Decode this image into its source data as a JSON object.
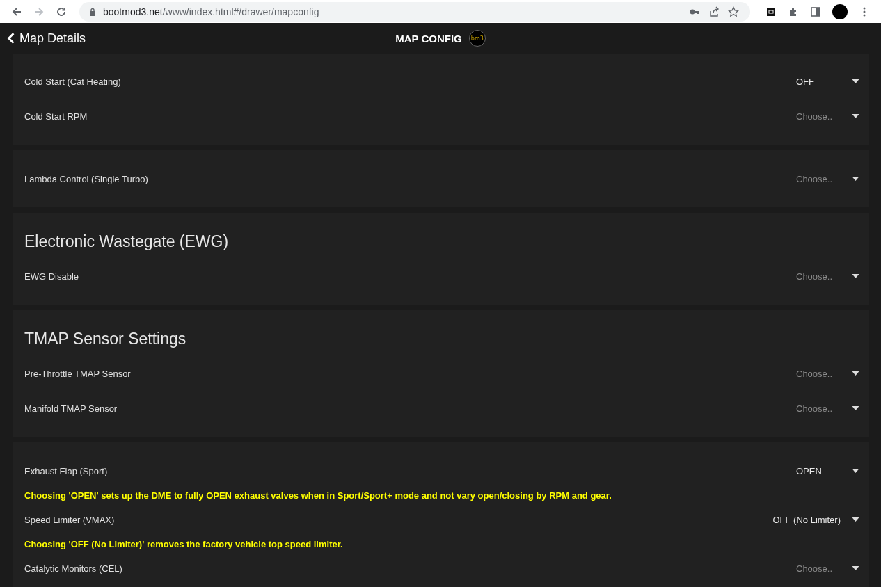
{
  "browser": {
    "url_host": "bootmod3.net",
    "url_path": "/www/index.html#/drawer/mapconfig"
  },
  "header": {
    "back_label": "Map Details",
    "title": "MAP CONFIG",
    "logo_text": "bm3"
  },
  "sections": [
    {
      "items": [
        {
          "kind": "select",
          "label": "Cold Start (Cat Heating)",
          "value": "OFF"
        },
        {
          "kind": "select",
          "label": "Cold Start RPM",
          "placeholder": "Choose.."
        }
      ]
    },
    {
      "items": [
        {
          "kind": "select",
          "label": "Lambda Control (Single Turbo)",
          "placeholder": "Choose.."
        }
      ]
    },
    {
      "title": "Electronic Wastegate (EWG)",
      "items": [
        {
          "kind": "select",
          "label": "EWG Disable",
          "placeholder": "Choose.."
        }
      ]
    },
    {
      "title": "TMAP Sensor Settings",
      "items": [
        {
          "kind": "select",
          "label": "Pre-Throttle TMAP Sensor",
          "placeholder": "Choose.."
        },
        {
          "kind": "select",
          "label": "Manifold TMAP Sensor",
          "placeholder": "Choose.."
        }
      ]
    },
    {
      "items": [
        {
          "kind": "select",
          "label": "Exhaust Flap (Sport)",
          "value": "OPEN"
        },
        {
          "kind": "hint",
          "text": "Choosing 'OPEN' sets up the DME to fully OPEN exhaust valves when in Sport/Sport+ mode and not vary open/closing by RPM and gear."
        },
        {
          "kind": "select",
          "label": "Speed Limiter (VMAX)",
          "value": "OFF (No Limiter)"
        },
        {
          "kind": "hint",
          "text": "Choosing 'OFF (No Limiter)' removes the factory vehicle top speed limiter."
        },
        {
          "kind": "select",
          "label": "Catalytic Monitors (CEL)",
          "placeholder": "Choose.."
        }
      ]
    }
  ]
}
